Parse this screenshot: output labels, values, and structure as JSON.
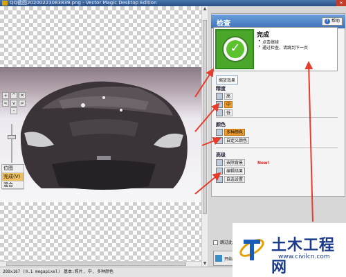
{
  "window": {
    "title": "QQ截图20200223083839.png - Vector Magic Desktop Edition",
    "close_symbol": "✕"
  },
  "navpad": {
    "left": "<",
    "right": ">",
    "up": "^",
    "down": "v",
    "zoom_in": "+",
    "zoom_out": "-",
    "fit": "✕"
  },
  "view_modes": [
    {
      "label": "位图"
    },
    {
      "label": "完成",
      "active": true,
      "badge": "(V)"
    },
    {
      "label": "混合"
    }
  ],
  "panel": {
    "title": "检查",
    "help_label": "帮助",
    "done": {
      "title": "完成",
      "bullets": [
        "点击继续",
        "通过检查，请跳到下一页"
      ]
    },
    "compare_tab": "缩放效果",
    "sections": [
      {
        "title": "精度",
        "options": [
          {
            "label": "高",
            "selected": false
          },
          {
            "label": "中",
            "selected": true
          },
          {
            "label": "低",
            "selected": false
          }
        ]
      },
      {
        "title": "颜色",
        "options": [
          {
            "label": "多种颜色",
            "selected": true
          },
          {
            "label": "自定义颜色",
            "selected": false
          }
        ]
      },
      {
        "title": "高级",
        "options": [
          {
            "label": "去除背景",
            "selected": false,
            "tag": "New!"
          },
          {
            "label": "编辑结果",
            "selected": false,
            "bold": true
          },
          {
            "label": "自选设置",
            "selected": false
          }
        ]
      }
    ],
    "skip_checkbox_label": "跳过此",
    "start_button_label": "开始"
  },
  "status": {
    "size": "289x187 (0.1 megapixel)",
    "mode": "基本:照片, 中, 多种颜色"
  },
  "watermark": {
    "title": "土木工程网",
    "url": "www.civilcn.com"
  },
  "colors": {
    "accent_blue": "#3e72b8",
    "selected_orange": "#f0a030",
    "done_green": "#4aa72a",
    "annotation_red": "#e53c2c",
    "watermark_blue": "#1a3a8a"
  }
}
